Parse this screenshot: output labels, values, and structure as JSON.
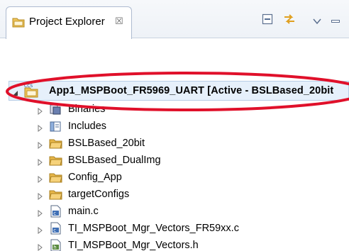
{
  "view": {
    "title": "Project Explorer",
    "close_glyph": "☒",
    "icon": "project-explorer-icon",
    "toolbar": {
      "collapse_all_icon": "collapse-all-icon",
      "link_editor_icon": "link-with-editor-icon",
      "view_menu_icon": "view-menu-chevron-icon",
      "minimize_icon": "minimize-icon"
    }
  },
  "tree": {
    "project": {
      "label": "App1_MSPBoot_FR5969_UART  [Active - BSLBased_20bit",
      "badge": "CCS",
      "expanded": true
    },
    "children": [
      {
        "label": "Binaries",
        "icon": "binaries-icon"
      },
      {
        "label": "Includes",
        "icon": "includes-icon"
      },
      {
        "label": "BSLBased_20bit",
        "icon": "folder-icon"
      },
      {
        "label": "BSLBased_DualImg",
        "icon": "folder-icon"
      },
      {
        "label": "Config_App",
        "icon": "folder-icon"
      },
      {
        "label": "targetConfigs",
        "icon": "folder-icon"
      },
      {
        "label": "main.c",
        "icon": "c-file-icon"
      },
      {
        "label": "TI_MSPBoot_Mgr_Vectors_FR59xx.c",
        "icon": "c-file-icon"
      },
      {
        "label": "TI_MSPBoot_Mgr_Vectors.h",
        "icon": "h-file-icon"
      }
    ]
  },
  "colors": {
    "annotation_ellipse": "#e0102a",
    "selection_bg": "#e6f0fb",
    "folder": "#e9b84a"
  }
}
